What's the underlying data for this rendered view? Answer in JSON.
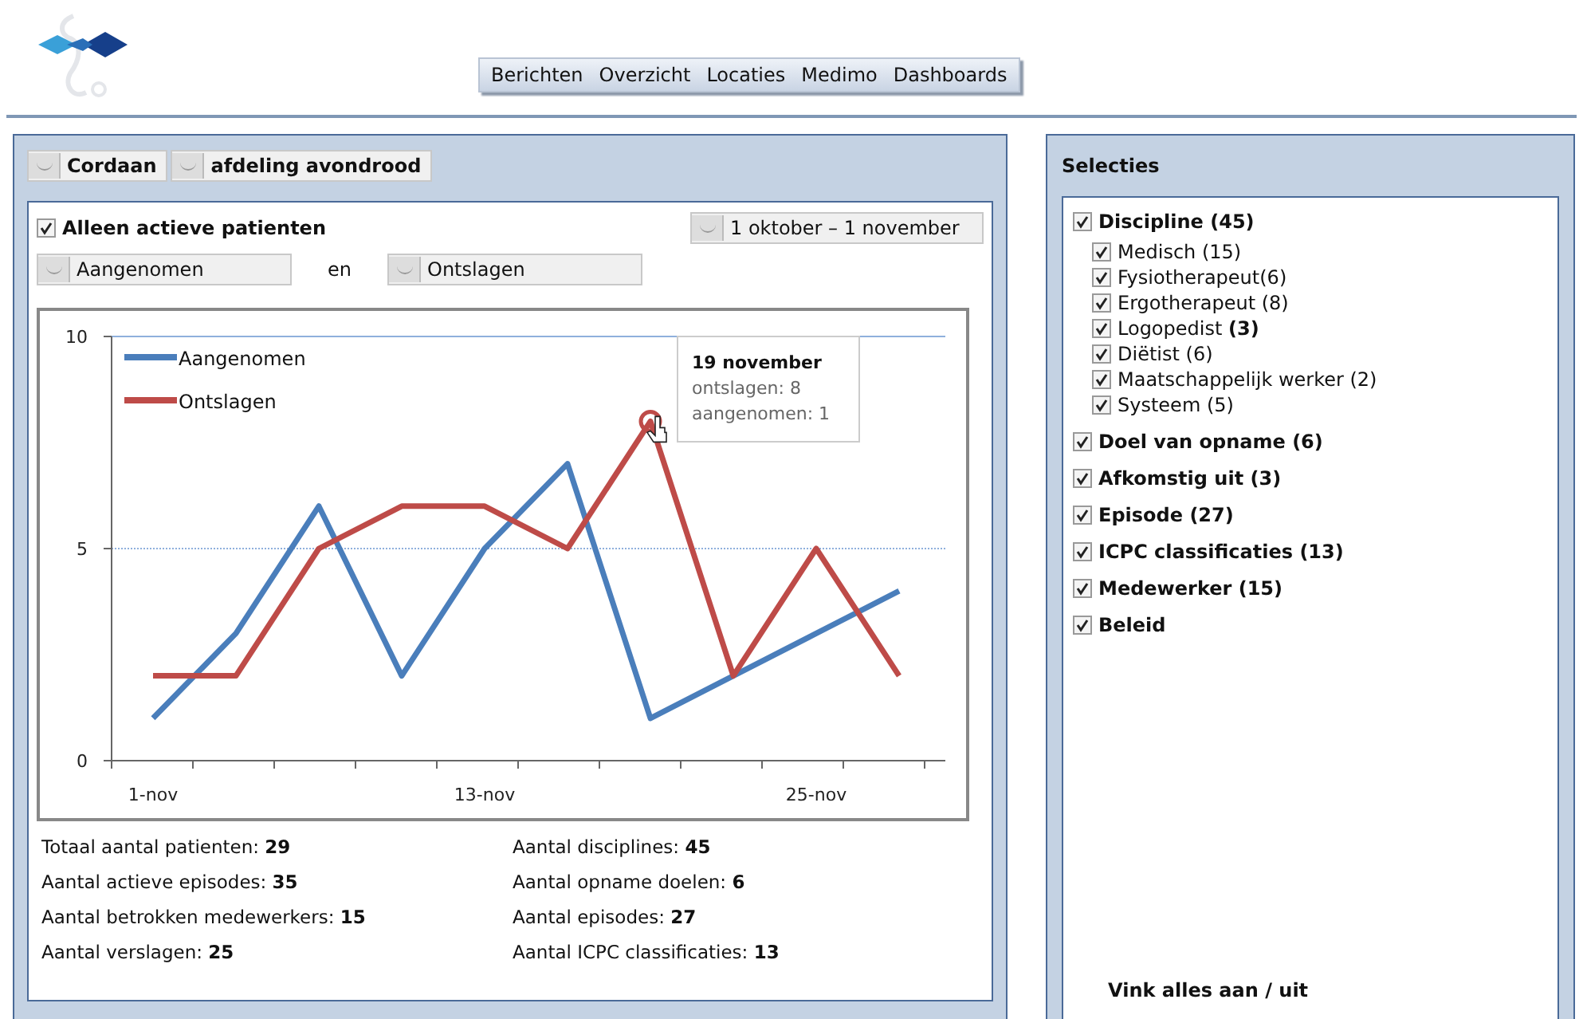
{
  "nav": [
    {
      "label": "Berichten"
    },
    {
      "label": "Overzicht"
    },
    {
      "label": "Locaties"
    },
    {
      "label": "Medimo"
    },
    {
      "label": "Dashboards"
    }
  ],
  "filters": [
    {
      "label": "Cordaan"
    },
    {
      "label": "afdeling avondrood"
    }
  ],
  "main": {
    "active_only": {
      "label": "Alleen actieve patienten",
      "checked": true
    },
    "period": {
      "label": "1 oktober – 1 november"
    },
    "series_a": {
      "label": "Aangenomen"
    },
    "joiner": "en",
    "series_b": {
      "label": "Ontslagen"
    },
    "tooltip": {
      "title": "19 november",
      "lines": [
        "ontslagen: 8",
        "aangenomen: 1"
      ]
    },
    "chart_data": {
      "type": "line",
      "categories": [
        "1-nov",
        null,
        null,
        null,
        "13-nov",
        null,
        null,
        null,
        "25-nov",
        null
      ],
      "series": [
        {
          "name": "Aangenomen",
          "color": "#4a7ebb",
          "values": [
            1,
            3,
            6,
            2,
            5,
            7,
            1,
            2,
            3,
            4
          ]
        },
        {
          "name": "Ontslagen",
          "color": "#be4b48",
          "values": [
            2,
            2,
            5,
            6,
            6,
            5,
            8,
            2,
            5,
            2
          ]
        }
      ],
      "ylim": [
        0,
        10
      ],
      "yticks": [
        0,
        5,
        10
      ],
      "legend": "top left",
      "ref_lines": [
        {
          "axis": "y",
          "value": 5
        }
      ]
    },
    "stats": [
      [
        "Totaal aantal patienten: **29**",
        "Aantal actieve episodes: **35**",
        "Aantal betrokken medewerkers: **15**",
        "Aantal verslagen: **25**"
      ],
      [
        "Aantal disciplines: **45**",
        "Aantal opname doelen: **6**",
        "Aantal episodes: **27**",
        "Aantal ICPC classificaties: **13**"
      ]
    ]
  },
  "selections": {
    "title": "Selecties",
    "groups": [
      {
        "label": "Discipline (45)",
        "checked": true,
        "children": [
          {
            "label": "Medisch (15)",
            "checked": true
          },
          {
            "label": "Fysiotherapeut(6)",
            "checked": true
          },
          {
            "label": "Ergotherapeut (8)",
            "checked": true
          },
          {
            "label": "Logopedist **(3)**",
            "checked": true
          },
          {
            "label": "Diëtist (6)",
            "checked": true
          },
          {
            "label": "Maatschappelijk werker (2)",
            "checked": true
          },
          {
            "label": "Systeem (5)",
            "checked": true
          }
        ]
      },
      {
        "label": "Doel van opname (6)",
        "checked": true
      },
      {
        "label": "Afkomstig uit (3)",
        "checked": true
      },
      {
        "label": "Episode (27)",
        "checked": true
      },
      {
        "label": "ICPC classificaties (13)",
        "checked": true
      },
      {
        "label": "Medewerker (15)",
        "checked": true
      },
      {
        "label": "Beleid",
        "checked": true
      }
    ],
    "toggle_all": "Vink alles aan / uit"
  }
}
